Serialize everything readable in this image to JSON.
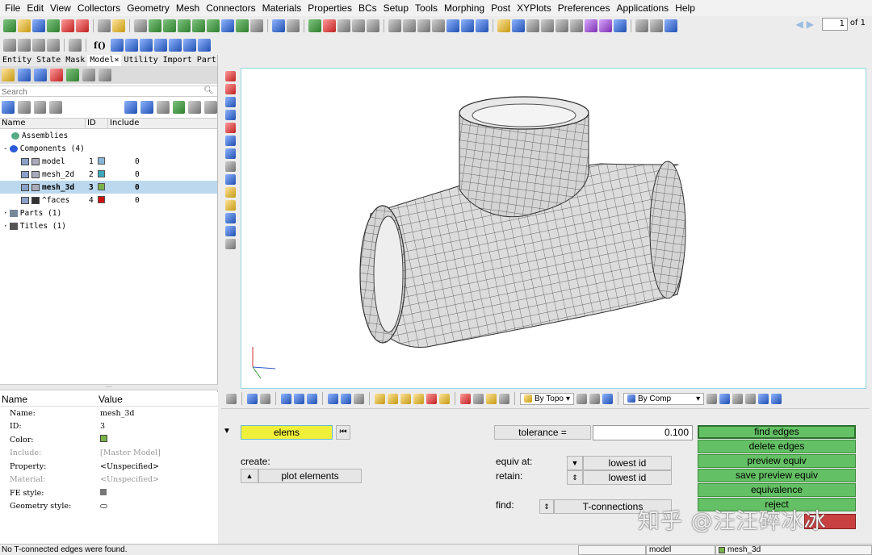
{
  "menu": [
    "File",
    "Edit",
    "View",
    "Collectors",
    "Geometry",
    "Mesh",
    "Connectors",
    "Materials",
    "Properties",
    "BCs",
    "Setup",
    "Tools",
    "Morphing",
    "Post",
    "XYPlots",
    "Preferences",
    "Applications",
    "Help"
  ],
  "page_nav": {
    "current": "1",
    "of_label": "of 1"
  },
  "toolbar2_label": "f()",
  "tabs": [
    "Entity State",
    "Mask",
    "Model×",
    "Utility",
    "Import",
    "Part"
  ],
  "search": {
    "placeholder": "Search"
  },
  "tree_header": {
    "name": "Name",
    "id": "ID",
    "include": "Include"
  },
  "tree": {
    "assemblies": "Assemblies",
    "components": "Components (4)",
    "parts": "Parts (1)",
    "titles": "Titles (1)",
    "items": [
      {
        "name": "model",
        "id": "1",
        "color": "#8ab4d8",
        "include": "0"
      },
      {
        "name": "mesh_2d",
        "id": "2",
        "color": "#3aa8b8",
        "include": "0"
      },
      {
        "name": "mesh_3d",
        "id": "3",
        "color": "#7ab34a",
        "include": "0"
      },
      {
        "name": "^faces",
        "id": "4",
        "color": "#d01010",
        "include": "0"
      }
    ]
  },
  "props_header": {
    "name": "Name",
    "value": "Value"
  },
  "props": [
    {
      "k": "Name:",
      "v": "mesh_3d"
    },
    {
      "k": "ID:",
      "v": "3"
    },
    {
      "k": "Color:",
      "v": ""
    },
    {
      "k": "Include:",
      "v": "[Master Model]"
    },
    {
      "k": "Property:",
      "v": "<Unspecified>"
    },
    {
      "k": "Material:",
      "v": "<Unspecified>"
    },
    {
      "k": "FE style:",
      "v": ""
    },
    {
      "k": "Geometry style:",
      "v": ""
    }
  ],
  "lowtool": {
    "topo": "By Topo",
    "comp": "By Comp"
  },
  "panel": {
    "elems": "elems",
    "create_label": "create:",
    "plot": "plot elements",
    "tol_label": "tolerance =",
    "tol_value": "0.100",
    "equiv_label": "equiv at:",
    "equiv_value": "lowest id",
    "retain_label": "retain:",
    "retain_value": "lowest id",
    "find_label": "find:",
    "find_value": "T-connections",
    "actions": [
      "find edges",
      "delete edges",
      "preview equiv",
      "save preview equiv",
      "equivalence",
      "reject"
    ]
  },
  "watermark": "知乎 @汪汪碎冰冰",
  "status": {
    "message": "No T-connected edges were found.",
    "box2": "model",
    "box3": "mesh_3d"
  },
  "colors": {
    "selected_row": "#bcd8ee",
    "action_green": "#64c064",
    "elems_yellow": "#f0f03a",
    "mesh_fill": "#d9d9d9"
  }
}
